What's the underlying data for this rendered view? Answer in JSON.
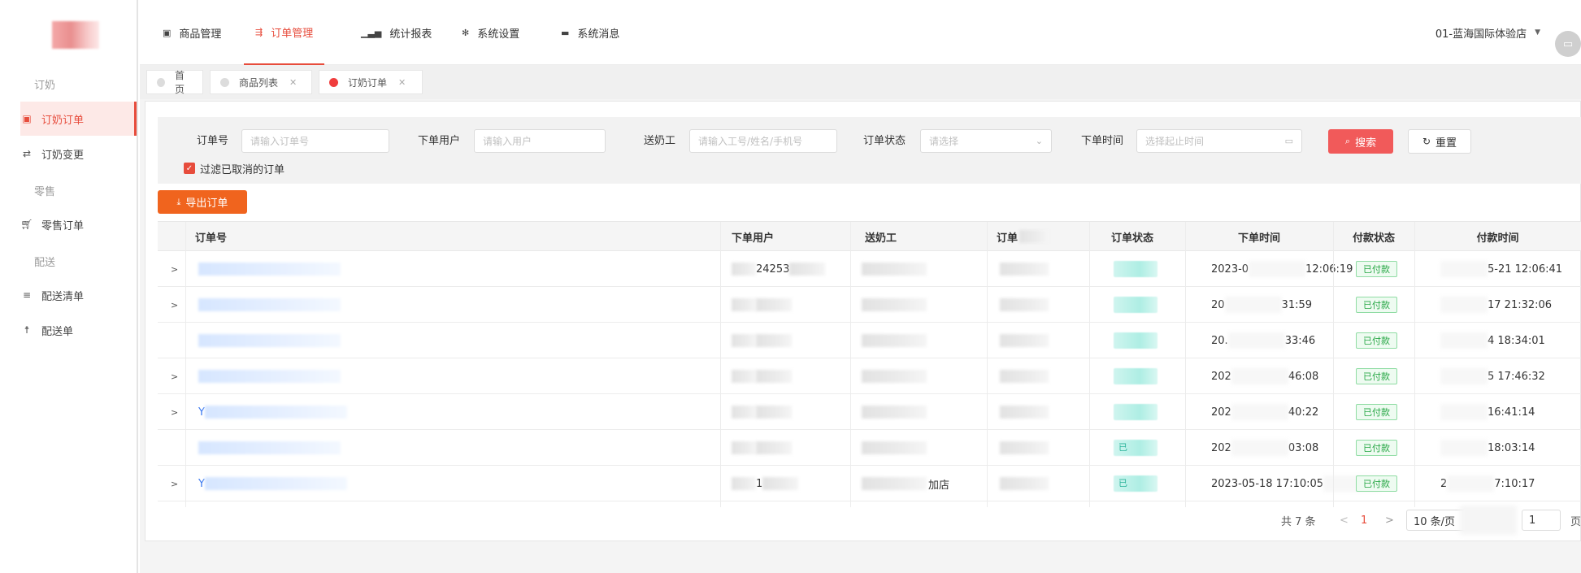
{
  "sidebar": {
    "groups": [
      "订奶",
      "零售",
      "配送"
    ],
    "items": [
      {
        "label": "订奶订单",
        "icon": "order-icon",
        "active": true
      },
      {
        "label": "订奶变更",
        "icon": "swap-icon"
      },
      {
        "label": "零售订单",
        "icon": "cart-icon"
      },
      {
        "label": "配送清单",
        "icon": "list-icon"
      },
      {
        "label": "配送单",
        "icon": "runner-icon"
      }
    ]
  },
  "topnav": {
    "items": [
      {
        "label": "商品管理",
        "icon": "goods-icon"
      },
      {
        "label": "订单管理",
        "icon": "order-manage-icon",
        "active": true
      },
      {
        "label": "统计报表",
        "icon": "bar-chart-icon"
      },
      {
        "label": "系统设置",
        "icon": "gear-icon"
      },
      {
        "label": "系统消息",
        "icon": "message-icon"
      }
    ],
    "store": "01-蓝海国际体验店"
  },
  "tabs": [
    {
      "label": "首页"
    },
    {
      "label": "商品列表"
    },
    {
      "label": "订奶订单",
      "active": true
    }
  ],
  "filters": {
    "order_no_label": "订单号",
    "order_no_placeholder": "请输入订单号",
    "user_label": "下单用户",
    "user_placeholder": "请输入用户",
    "courier_label": "送奶工",
    "courier_placeholder": "请输入工号/姓名/手机号",
    "status_label": "订单状态",
    "status_placeholder": "请选择",
    "time_label": "下单时间",
    "time_placeholder": "选择起止时间",
    "search": "搜索",
    "reset": "重置",
    "filter_cancelled": "过滤已取消的订单"
  },
  "export_label": "导出订单",
  "table": {
    "headers": [
      "订单号",
      "下单用户",
      "送奶工",
      "订单",
      "订单状态",
      "下单时间",
      "付款状态",
      "付款时间"
    ],
    "rows": [
      {
        "order_prefix": "",
        "user": "24253",
        "courier": "",
        "status": "",
        "order_time_a": "2023-0",
        "order_time_b": "12:06:19",
        "pay_status": "已付款",
        "pay_time_a": "",
        "pay_time_b": "5-21 12:06:41",
        "expand": ">"
      },
      {
        "order_prefix": "",
        "user": "",
        "courier": "",
        "status": "",
        "order_time_a": "20",
        "order_time_b": "31:59",
        "pay_status": "已付款",
        "pay_time_a": "",
        "pay_time_b": "17 21:32:06",
        "expand": ">"
      },
      {
        "order_prefix": "",
        "user": "",
        "courier": "",
        "status": "",
        "order_time_a": "20.",
        "order_time_b": "33:46",
        "pay_status": "已付款",
        "pay_time_a": "",
        "pay_time_b": "4 18:34:01",
        "expand": ""
      },
      {
        "order_prefix": "",
        "user": "",
        "courier": "",
        "status": "",
        "order_time_a": "202",
        "order_time_b": "46:08",
        "pay_status": "已付款",
        "pay_time_a": "",
        "pay_time_b": "5 17:46:32",
        "expand": ">"
      },
      {
        "order_prefix": "Y",
        "user": "",
        "courier": "",
        "status": "",
        "order_time_a": "202",
        "order_time_b": "40:22",
        "pay_status": "已付款",
        "pay_time_a": "",
        "pay_time_b": "16:41:14",
        "expand": ">"
      },
      {
        "order_prefix": "",
        "user": "",
        "courier": "",
        "status": "已",
        "order_time_a": "202",
        "order_time_b": "03:08",
        "pay_status": "已付款",
        "pay_time_a": "",
        "pay_time_b": "18:03:14",
        "expand": ""
      },
      {
        "order_prefix": "Y",
        "user": "1",
        "courier": "加店",
        "status": "已",
        "order_time_a": "2023-05-18 17:10:05",
        "order_time_b": "",
        "pay_status": "已付款",
        "pay_time_a": "2",
        "pay_time_b": "7:10:17",
        "expand": ">"
      }
    ]
  },
  "pagination": {
    "total": "共 7 条",
    "prev": "<",
    "current": "1",
    "next": ">",
    "page_size": "10 条/页",
    "goto": "1",
    "page_suffix": "页"
  },
  "colors": {
    "accent": "#e74c3c",
    "export": "#f0641e",
    "search": "#f15a5a",
    "link": "#3a78f0",
    "paid": "#27a745"
  }
}
